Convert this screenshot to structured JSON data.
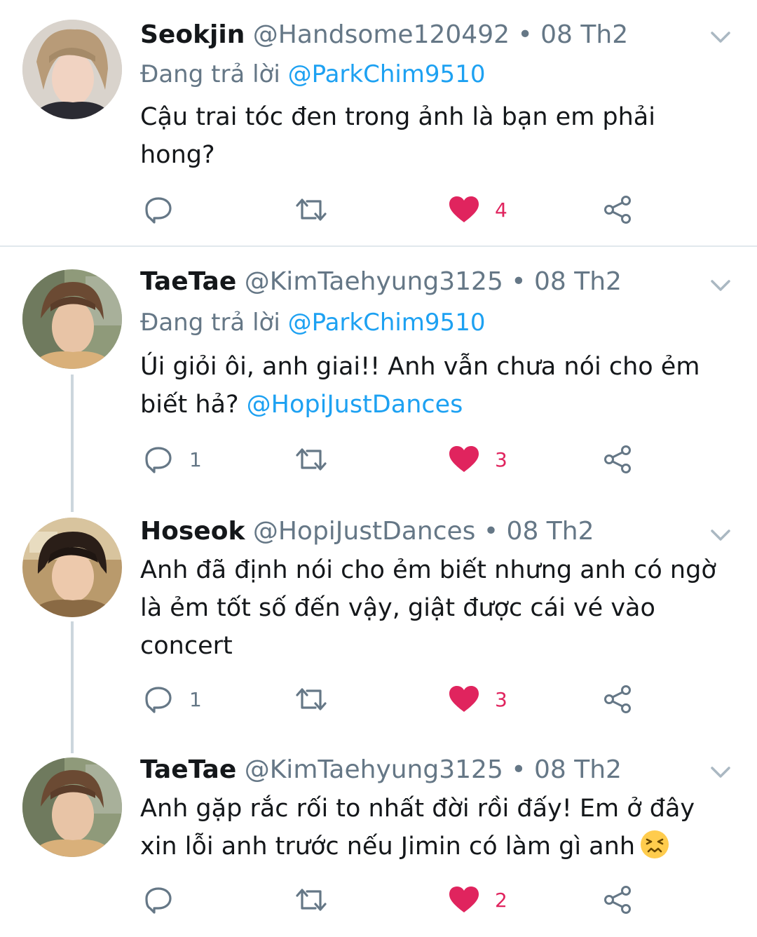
{
  "tweets": [
    {
      "name": "Seokjin",
      "handle": "@Handsome120492",
      "dot": "•",
      "date": "08 Th2",
      "reply_prefix": "Đang trả lời",
      "reply_to": "@ParkChim9510",
      "text": "Cậu trai tóc đen trong ảnh là bạn em phải hong?",
      "replies": "",
      "likes": "4"
    },
    {
      "name": "TaeTae",
      "handle": "@KimTaehyung3125",
      "dot": "•",
      "date": "08 Th2",
      "reply_prefix": "Đang trả lời",
      "reply_to": "@ParkChim9510",
      "text": "Úi giỏi ôi, anh giai!! Anh vẫn chưa nói cho ẻm biết hả?",
      "text_mention": "@HopiJustDances",
      "replies": "1",
      "likes": "3"
    },
    {
      "name": "Hoseok",
      "handle": "@HopiJustDances",
      "dot": "•",
      "date": "08 Th2",
      "text": "Anh đã định nói cho ẻm biết nhưng anh có ngờ là ẻm tốt số đến vậy, giật được cái vé vào concert",
      "replies": "1",
      "likes": "3"
    },
    {
      "name": "TaeTae",
      "handle": "@KimTaehyung3125",
      "dot": "•",
      "date": "08 Th2",
      "text": "Anh gặp rắc rối to nhất đời rồi đấy! Em ở đây xin lỗi anh trước nếu Jimin có làm gì anh",
      "emoji": "persevering-face-emoji",
      "replies": "",
      "likes": "2"
    }
  ],
  "icons": {
    "reply": "reply-icon",
    "retweet": "retweet-icon",
    "like": "heart-icon",
    "share": "share-icon",
    "caret": "chevron-down-icon"
  },
  "colors": {
    "like": "#e0245e",
    "mention": "#1da1f2",
    "muted": "#657786",
    "icon": "#657786",
    "thread_line": "#ccd6dd"
  }
}
